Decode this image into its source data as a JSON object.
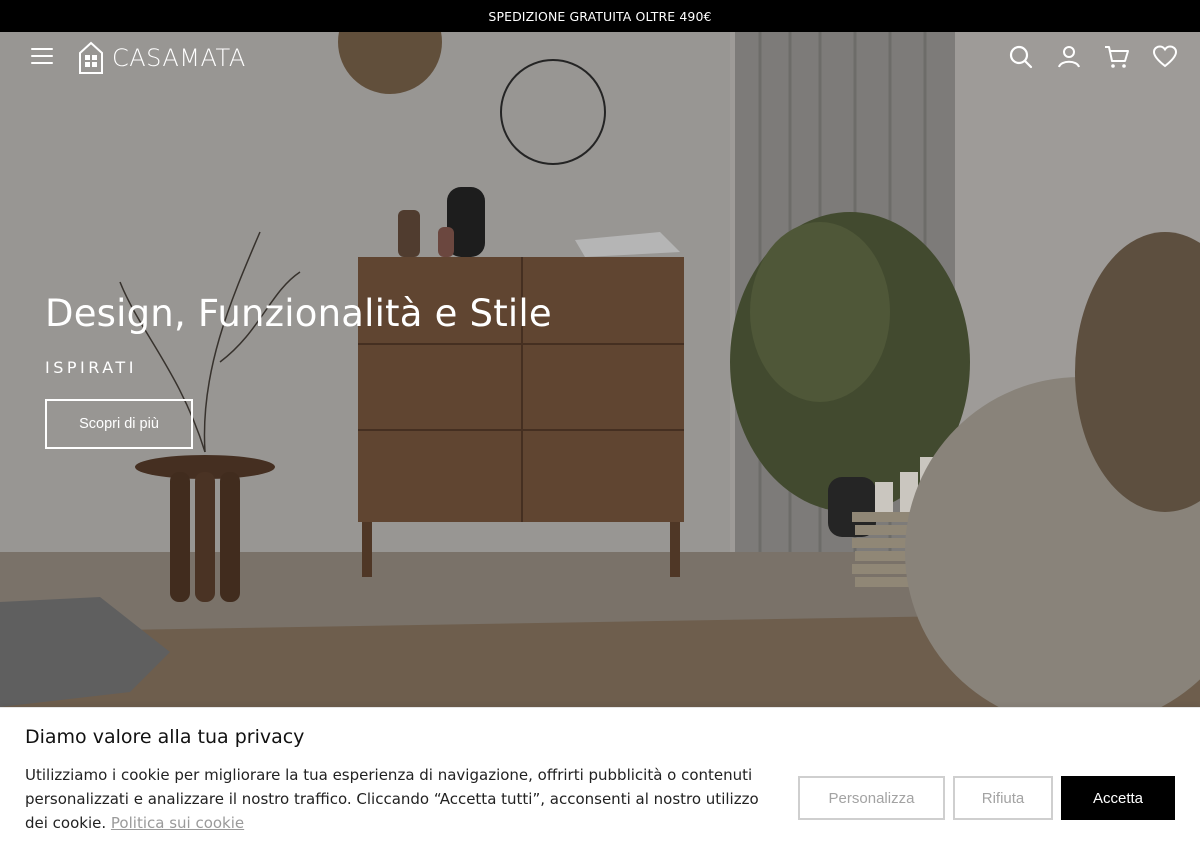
{
  "top_banner": {
    "text": "SPEDIZIONE GRATUITA OLTRE 490€"
  },
  "header": {
    "logo_text": "CASAMATA",
    "icons": [
      "menu-icon",
      "search-icon",
      "user-icon",
      "cart-icon",
      "heart-icon"
    ]
  },
  "hero": {
    "title": "Design, Funzionalità e Stile",
    "subtitle": "ISPIRATI",
    "cta_label": "Scopri di più"
  },
  "cookie_banner": {
    "title": "Diamo valore alla tua privacy",
    "text": "Utilizziamo i cookie per migliorare la tua esperienza di navigazione, offrirti pubblicità o contenuti personalizzati e analizzare il nostro traffico. Cliccando “Accetta tutti”, acconsenti al nostro utilizzo dei cookie.",
    "link_label": "Politica sui cookie",
    "buttons": {
      "customize": "Personalizza",
      "reject": "Rifiuta",
      "accept": "Accetta"
    }
  },
  "colors": {
    "banner_bg": "#000000",
    "accept_bg": "#000000",
    "outline_border": "#cfcfcf"
  }
}
